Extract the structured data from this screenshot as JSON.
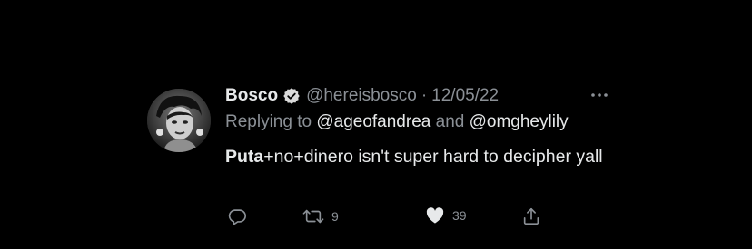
{
  "tweet": {
    "display_name": "Bosco",
    "handle": "@hereisbosco",
    "separator": "·",
    "date": "12/05/22",
    "replying_prefix": "Replying to",
    "reply_mention_1": "@ageofandrea",
    "reply_and": "and",
    "reply_mention_2": "@omgheylily",
    "body_bold": "Puta",
    "body_rest": "+no+dinero isn't super hard to decipher yall",
    "retweet_count": "9",
    "like_count": "39"
  },
  "icons": {
    "verified": "verified-badge-icon",
    "more": "more-horizontal-icon",
    "reply": "reply-icon",
    "retweet": "retweet-icon",
    "like": "heart-icon",
    "share": "share-icon"
  },
  "colors": {
    "background": "#000000",
    "primary_text": "#e7e9ea",
    "secondary_text": "#8b9096"
  }
}
